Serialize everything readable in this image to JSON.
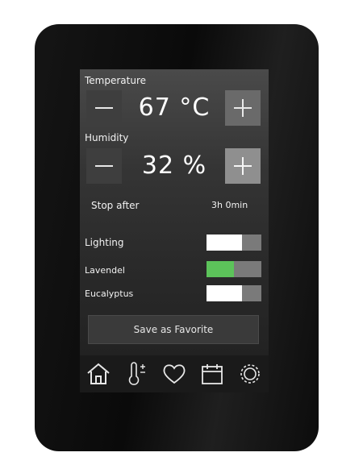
{
  "temperature": {
    "label": "Temperature",
    "value": "67 °C",
    "minus": "−",
    "plus": "+"
  },
  "humidity": {
    "label": "Humidity",
    "value": "32 %",
    "minus": "−",
    "plus": "+"
  },
  "timer": {
    "label": "Stop after",
    "value": "3h 0min"
  },
  "toggles": [
    {
      "label": "Lighting",
      "on": true,
      "color": "#ffffff"
    },
    {
      "label": "Lavendel",
      "on": true,
      "color": "#5cc35a"
    },
    {
      "label": "Eucalyptus",
      "on": true,
      "color": "#ffffff"
    }
  ],
  "favorite_button": "Save as Favorite",
  "nav": [
    {
      "icon": "home-icon"
    },
    {
      "icon": "thermometer-icon"
    },
    {
      "icon": "heart-icon"
    },
    {
      "icon": "calendar-icon"
    },
    {
      "icon": "settings-gear-icon"
    }
  ]
}
